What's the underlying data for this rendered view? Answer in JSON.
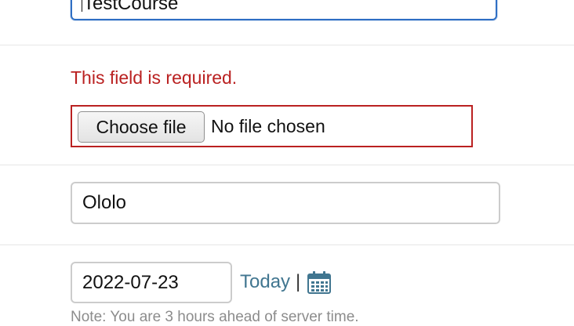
{
  "course_title_field": {
    "value": "TestCourse"
  },
  "file_field": {
    "error": "This field is required.",
    "button_label": "Choose file",
    "status": "No file chosen"
  },
  "text_field": {
    "value": "Ololo"
  },
  "date_field": {
    "value": "2022-07-23",
    "today_label": "Today",
    "separator": "|",
    "calendar_icon": "calendar-icon",
    "note": "Note: You are 3 hours ahead of server time."
  },
  "colors": {
    "error": "#ba2121",
    "link": "#417690",
    "focus": "#2f6fc4"
  }
}
